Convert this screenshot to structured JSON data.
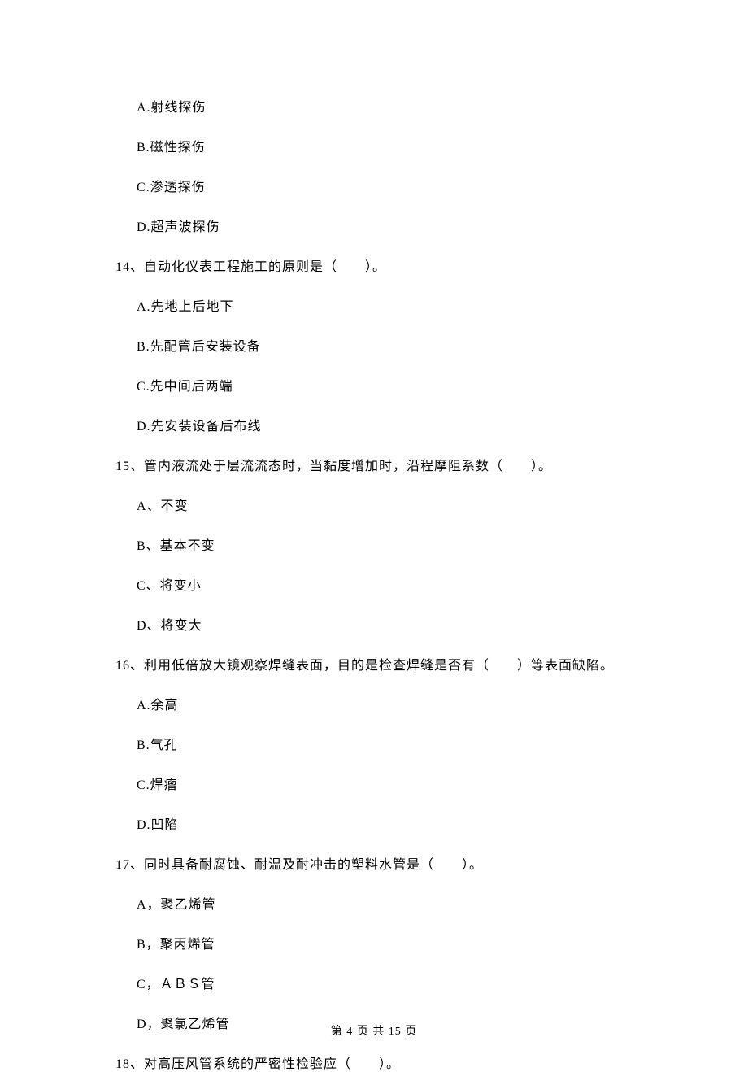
{
  "q13": {
    "options": {
      "a": "A.射线探伤",
      "b": "B.磁性探伤",
      "c": "C.渗透探伤",
      "d": "D.超声波探伤"
    }
  },
  "q14": {
    "stem": "14、自动化仪表工程施工的原则是（　　）。",
    "options": {
      "a": "A.先地上后地下",
      "b": "B.先配管后安装设备",
      "c": "C.先中间后两端",
      "d": "D.先安装设备后布线"
    }
  },
  "q15": {
    "stem": "15、管内液流处于层流流态时，当黏度增加时，沿程摩阻系数（　　）。",
    "options": {
      "a": "A、不变",
      "b": "B、基本不变",
      "c": "C、将变小",
      "d": "D、将变大"
    }
  },
  "q16": {
    "stem": "16、利用低倍放大镜观察焊缝表面，目的是检查焊缝是否有（　　）等表面缺陷。",
    "options": {
      "a": "A.余高",
      "b": "B.气孔",
      "c": "C.焊瘤",
      "d": "D.凹陷"
    }
  },
  "q17": {
    "stem": "17、同时具备耐腐蚀、耐温及耐冲击的塑料水管是（　　）。",
    "options": {
      "a": "A，聚乙烯管",
      "b": "B，聚丙烯管",
      "c": "C，ＡＢＳ管",
      "d": "D，聚氯乙烯管"
    }
  },
  "q18": {
    "stem": "18、对高压风管系统的严密性检验应（　　）。"
  },
  "footer": {
    "text": "第 4 页 共 15 页"
  }
}
